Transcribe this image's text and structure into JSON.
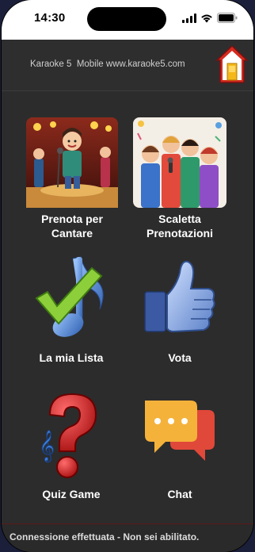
{
  "status_bar": {
    "time": "14:30"
  },
  "header": {
    "title": "Karaoke 5  Mobile www.karaoke5.com",
    "home_icon": "home-icon"
  },
  "menu": [
    {
      "label": "Prenota per\nCantare",
      "icon": "singer-stage-image"
    },
    {
      "label": "Scaletta\nPrenotazioni",
      "icon": "crowd-singing-image"
    },
    {
      "label": "La mia Lista",
      "icon": "music-note-check-icon"
    },
    {
      "label": "Vota",
      "icon": "thumbs-up-icon"
    },
    {
      "label": "Quiz Game",
      "icon": "question-mark-icon"
    },
    {
      "label": "Chat",
      "icon": "chat-bubbles-icon"
    }
  ],
  "footer": {
    "status_text": "Connessione effettuata - Non sei abilitato."
  },
  "colors": {
    "background": "#2c2c2c",
    "home_red": "#d62a1e",
    "home_yellow": "#f5b81a"
  }
}
